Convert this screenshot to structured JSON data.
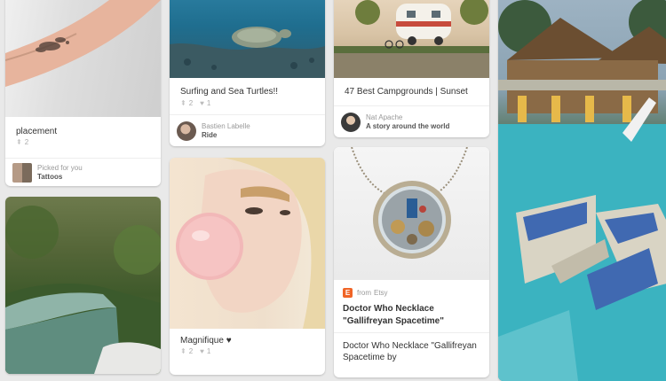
{
  "pins": {
    "placement": {
      "description": "placement",
      "repins": "2",
      "attribution_top": "Picked for you",
      "attribution_bottom": "Tattoos"
    },
    "turtles": {
      "description": "Surfing and Sea Turtles!!",
      "repins": "2",
      "likes": "1",
      "attribution_top": "Bastien Labelle",
      "attribution_bottom": "Ride"
    },
    "campgrounds": {
      "description": "47 Best Campgrounds | Sunset",
      "attribution_top": "Nat Apache",
      "attribution_bottom": "A story around the world"
    },
    "magnifique": {
      "description": "Magnifique ♥",
      "repins": "2",
      "likes": "1"
    },
    "necklace": {
      "source_prefix": "from",
      "source_name": "Etsy",
      "source_icon_letter": "E",
      "title": "Doctor Who Necklace \"Gallifreyan Spacetime\"",
      "description": "Doctor Who Necklace \"Gallifreyan Spacetime by"
    }
  },
  "icons": {
    "repin": "pin-icon",
    "like": "heart-icon",
    "source": "etsy-icon"
  },
  "colors": {
    "background": "#e9e9e9",
    "etsy_orange": "#f06426"
  }
}
